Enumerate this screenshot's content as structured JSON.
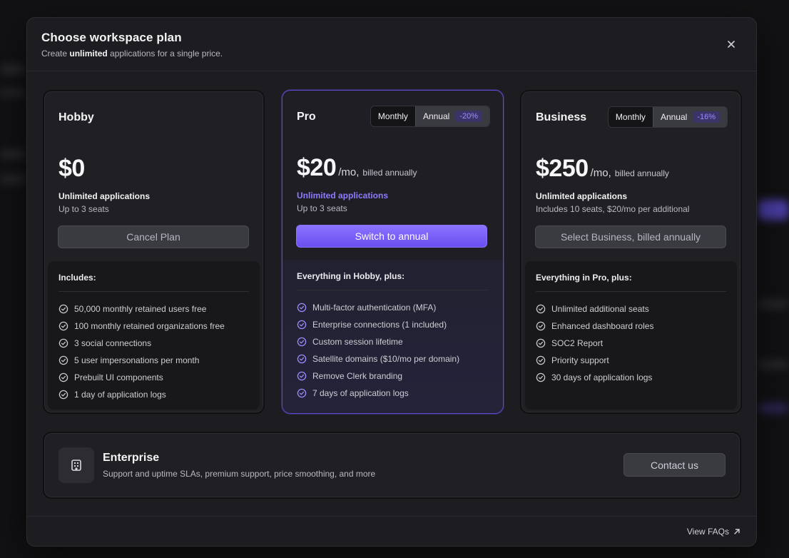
{
  "header": {
    "title": "Choose workspace plan",
    "subtitle_prefix": "Create ",
    "subtitle_bold": "unlimited",
    "subtitle_suffix": " applications for a single price.",
    "close_label": "×"
  },
  "plans": [
    {
      "name": "Hobby",
      "price": "$0",
      "applications": "Unlimited applications",
      "seats": "Up to 3 seats",
      "cta": "Cancel Plan",
      "features_title": "Includes:",
      "features": [
        "50,000 monthly retained users free",
        "100 monthly retained organizations free",
        "3 social connections",
        "5 user impersonations per month",
        "Prebuilt UI components",
        "1 day of application logs"
      ]
    },
    {
      "name": "Pro",
      "toggle_monthly": "Monthly",
      "toggle_annual": "Annual",
      "discount": "-20%",
      "price": "$20",
      "price_unit": "/mo,",
      "billing": "billed annually",
      "applications": "Unlimited applications",
      "seats": "Up to 3 seats",
      "cta": "Switch to annual",
      "features_title": "Everything in Hobby, plus:",
      "features": [
        "Multi-factor authentication (MFA)",
        "Enterprise connections (1 included)",
        "Custom session lifetime",
        "Satellite domains ($10/mo per domain)",
        "Remove Clerk branding",
        "7 days of application logs"
      ]
    },
    {
      "name": "Business",
      "toggle_monthly": "Monthly",
      "toggle_annual": "Annual",
      "discount": "-16%",
      "price": "$250",
      "price_unit": "/mo,",
      "billing": "billed annually",
      "applications": "Unlimited applications",
      "seats": "Includes 10 seats, $20/mo per additional",
      "cta": "Select Business, billed annually",
      "features_title": "Everything in Pro, plus:",
      "features": [
        "Unlimited additional seats",
        "Enhanced dashboard roles",
        "SOC2 Report",
        "Priority support",
        "30 days of application logs"
      ]
    }
  ],
  "enterprise": {
    "title": "Enterprise",
    "description": "Support and uptime SLAs, premium support, price smoothing, and more",
    "cta": "Contact us",
    "icon": "building-icon"
  },
  "footer": {
    "faq_label": "View FAQs",
    "faq_icon": "arrow-up-right-icon"
  },
  "colors": {
    "accent": "#8c72ff",
    "accent_dark": "#6b4ff0",
    "background": "#1d1d21"
  }
}
